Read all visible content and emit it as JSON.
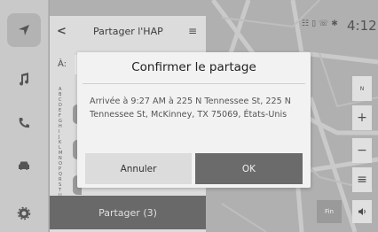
{
  "panel": {
    "title": "Partager l'HAP",
    "to_label": "À:",
    "alphabet": [
      "A",
      "B",
      "C",
      "D",
      "E",
      "F",
      "G",
      "H",
      "I",
      "J",
      "K",
      "L",
      "M",
      "N",
      "O",
      "P",
      "Q",
      "R",
      "S",
      "T",
      "U"
    ],
    "share_label": "Partager (3)"
  },
  "status": {
    "time": "4:12",
    "icons": [
      "satellite-signal-icon",
      "cellular-signal-icon",
      "phone-icon",
      "bluetooth-icon"
    ]
  },
  "map_controls": {
    "compass_label": "N",
    "zoom_in": "+",
    "zoom_out": "−",
    "menu": "≡",
    "fin_label": "Fin",
    "volume": "speaker-icon"
  },
  "dialog": {
    "title": "Confirmer le partage",
    "message": "Arrivée à 9:27 AM à 225 N Tennessee St, 225 N Tennessee St, McKinney, TX 75069, États-Unis",
    "cancel_label": "Annuler",
    "ok_label": "OK"
  },
  "rail": {
    "items": [
      "navigation-icon",
      "music-icon",
      "phone-icon",
      "car-icon",
      "settings-icon"
    ]
  }
}
